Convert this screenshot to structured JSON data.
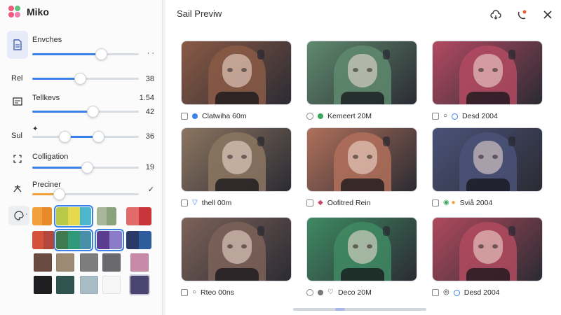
{
  "app": {
    "title": "Miko"
  },
  "panel": {
    "controls": [
      {
        "label": "Envches",
        "value": "· ·"
      },
      {
        "label": "Rel",
        "value": "38"
      },
      {
        "label": "Tellkevs",
        "value": "42",
        "extra": "1.54"
      },
      {
        "label": "Sul",
        "value": "36"
      },
      {
        "label": "Colligation",
        "value": "19"
      },
      {
        "label": "Preciner",
        "value": "✓"
      }
    ],
    "bullet": "·"
  },
  "preview": {
    "title": "Sail Previw",
    "cards": [
      {
        "caption": "Clatwiha 60m"
      },
      {
        "caption": "Kemeert 20M"
      },
      {
        "caption": "Desd 2004"
      },
      {
        "caption": "thell 00m"
      },
      {
        "caption": "Oofitred Rein"
      },
      {
        "caption": "Sviå 2004"
      },
      {
        "caption": "Rteo 00ns"
      },
      {
        "caption": "Deco 20M"
      },
      {
        "caption": "Desd 2004"
      }
    ]
  },
  "colors": {
    "accent": "#3b82e8",
    "slider_orange": "#f2a03c",
    "tints": [
      "#8a5a45",
      "#5f8a6e",
      "#b24a62",
      "#8c7560",
      "#b0705a",
      "#4a5278",
      "#7d6258",
      "#3f8a63",
      "#b04a5e"
    ]
  },
  "icons": {
    "header": [
      "cloud-sync-icon",
      "refresh-phone-icon",
      "close-icon"
    ]
  }
}
